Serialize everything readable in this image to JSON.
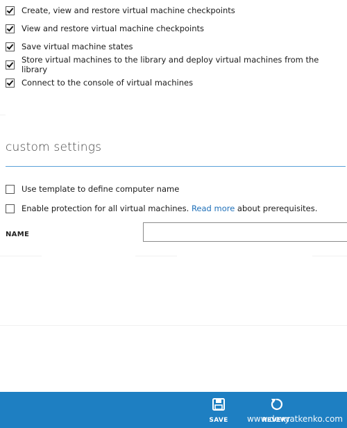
{
  "permissions": [
    {
      "label": "Create, view and restore virtual machine checkpoints",
      "checked": true
    },
    {
      "label": "View and restore virtual machine checkpoints",
      "checked": true
    },
    {
      "label": "Save virtual machine states",
      "checked": true
    },
    {
      "label": "Store virtual machines to the library and deploy virtual machines from the library",
      "checked": true
    },
    {
      "label": "Connect to the console of virtual machines",
      "checked": true
    }
  ],
  "custom_settings": {
    "title": "custom settings",
    "use_template": {
      "label": "Use template to define computer name",
      "checked": false
    },
    "protection": {
      "label_before": "Enable protection for all virtual machines.",
      "link": "Read more",
      "label_after": " about prerequisites.",
      "checked": false
    },
    "name_label": "NAME",
    "name_value": ""
  },
  "commands": {
    "save": "SAVE",
    "revert": "REVERT"
  },
  "watermark": "www.devyatkenko.com",
  "colors": {
    "command_bar": "#1e7fc2",
    "accent_rule": "#5aa0d8",
    "link": "#1e6fb8"
  }
}
